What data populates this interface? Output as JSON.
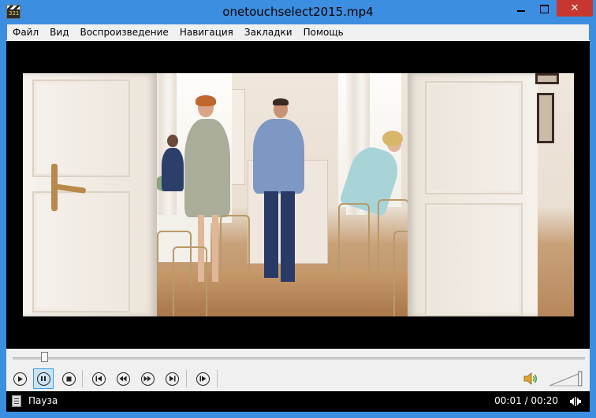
{
  "window": {
    "title": "onetouchselect2015.mp4",
    "app_icon": "film-clapper-icon",
    "app_icon_label": "321",
    "buttons": {
      "minimize": "minimize-icon",
      "maximize": "maximize-icon",
      "close": "✕"
    }
  },
  "menu": [
    {
      "label": "Файл"
    },
    {
      "label": "Вид"
    },
    {
      "label": "Воспроизведение"
    },
    {
      "label": "Навигация"
    },
    {
      "label": "Закладки"
    },
    {
      "label": "Помощь"
    }
  ],
  "video": {
    "content": "movie-frame",
    "playback_position_fraction": 0.05
  },
  "controls": {
    "buttons": [
      {
        "name": "play-button",
        "icon": "play-icon",
        "active": false
      },
      {
        "name": "pause-button",
        "icon": "pause-icon",
        "active": true
      },
      {
        "name": "stop-button",
        "icon": "stop-icon",
        "active": false
      },
      {
        "name": "previous-button",
        "icon": "skip-back-icon",
        "active": false
      },
      {
        "name": "rewind-button",
        "icon": "rewind-icon",
        "active": false
      },
      {
        "name": "fast-forward-button",
        "icon": "fast-forward-icon",
        "active": false
      },
      {
        "name": "next-button",
        "icon": "skip-forward-icon",
        "active": false
      },
      {
        "name": "frame-step-button",
        "icon": "frame-step-icon",
        "active": false
      }
    ],
    "volume_icon": "speaker-icon",
    "volume_level": 0.9
  },
  "status": {
    "text": "Пауза",
    "time": "00:01 / 00:20",
    "audio_icon": "stereo-icon"
  },
  "colors": {
    "titlebar": "#3c8ee0",
    "close_button": "#c7372f",
    "active_button_bg": "#cce4f7",
    "active_button_border": "#3c9be8"
  }
}
